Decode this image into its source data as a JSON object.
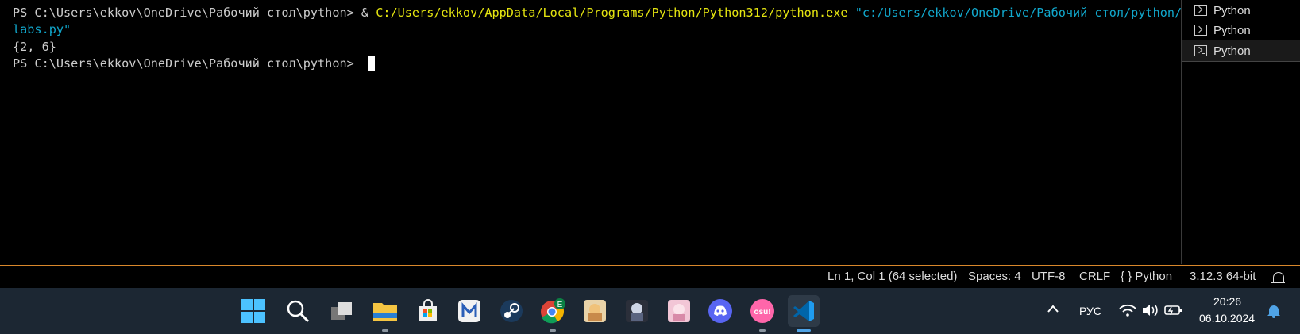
{
  "terminal": {
    "line1_prompt": "PS C:\\Users\\ekkov\\OneDrive\\Рабочий стол\\python> ",
    "line1_amp": "& ",
    "line1_exe": "C:/Users/ekkov/AppData/Local/Programs/Python/Python312/python.exe",
    "line1_arg": " \"c:/Users/ekkov/OneDrive/Рабочий стол/python/",
    "line2_arg": "labs.py\"",
    "output": "{2, 6}",
    "prompt2": "PS C:\\Users\\ekkov\\OneDrive\\Рабочий стол\\python> "
  },
  "terminal_list": [
    {
      "label": "Python"
    },
    {
      "label": "Python"
    },
    {
      "label": "Python"
    }
  ],
  "statusbar": {
    "position": "Ln 1, Col 1 (64 selected)",
    "spaces": "Spaces: 4",
    "encoding": "UTF-8",
    "eol": "CRLF",
    "language": "Python",
    "language_icon": "{ }",
    "interpreter": "3.12.3 64-bit"
  },
  "taskbar": {
    "apps": [
      {
        "name": "start"
      },
      {
        "name": "search"
      },
      {
        "name": "task-view"
      },
      {
        "name": "file-explorer"
      },
      {
        "name": "microsoft-store"
      },
      {
        "name": "app-m"
      },
      {
        "name": "steam"
      },
      {
        "name": "chrome"
      },
      {
        "name": "game-1"
      },
      {
        "name": "game-2"
      },
      {
        "name": "game-3"
      },
      {
        "name": "discord"
      },
      {
        "name": "osu"
      },
      {
        "name": "vscode"
      }
    ],
    "chrome_badge": "E",
    "osu_label": "osu!",
    "language": "РУС",
    "time": "20:26",
    "date": "06.10.2024"
  },
  "colors": {
    "accent": "#d9872b",
    "taskbar": "#1c2733",
    "exe_path": "#e5e510",
    "string_arg": "#11a8cd"
  }
}
